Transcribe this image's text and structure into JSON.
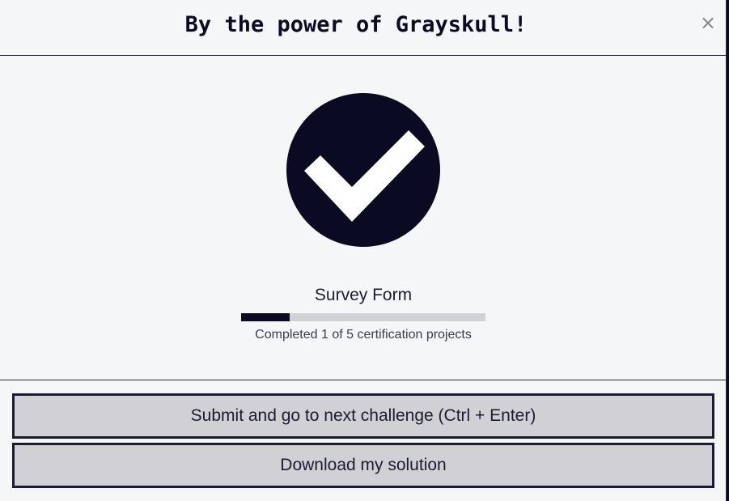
{
  "modal": {
    "title": "By the power of Grayskull!",
    "close_label": "×"
  },
  "body": {
    "success_icon": "check-circle-icon",
    "project_title": "Survey Form",
    "progress": {
      "completed": 1,
      "total": 5,
      "fraction": 0.2,
      "text": "Completed 1 of 5 certification projects"
    }
  },
  "actions": {
    "submit_label": "Submit and go to next challenge (Ctrl + Enter)",
    "download_label": "Download my solution"
  },
  "colors": {
    "dark": "#0a0a23",
    "panel_bg": "#f5f6f7",
    "button_bg": "#d0d0d5",
    "text": "#1b1b32"
  }
}
